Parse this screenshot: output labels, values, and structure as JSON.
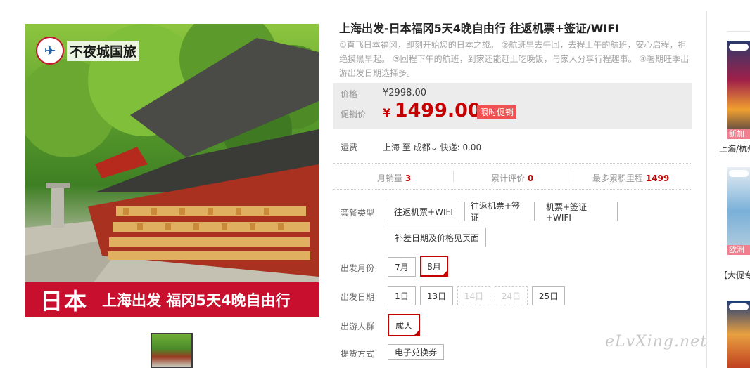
{
  "image": {
    "logo_text": "不夜城国旅",
    "banner_main": "日本",
    "banner_sub": "上海出发 福冈5天4晚自由行"
  },
  "product": {
    "title": "上海出发-日本福冈5天4晚自由行 往返机票+签证/WIFI",
    "description": "①直飞日本福冈，即刻开始您的日本之旅。 ②航班早去午回，去程上午的航班，安心启程，拒绝摸黑早起。 ③回程下午的航班，到家还能赶上吃晚饭，与家人分享行程趣事。 ④署期旺季出游出发日期选择多。"
  },
  "price": {
    "orig_label": "价格",
    "orig_value": "¥2998.00",
    "sale_label": "促销价",
    "sale_currency": "¥",
    "sale_value": "1499.00",
    "sale_tag": "限时促销"
  },
  "shipping": {
    "label": "运费",
    "from": "上海",
    "to_word": "至",
    "to": "成都",
    "method": "快递: 0.00"
  },
  "stats": {
    "monthly_label": "月销量",
    "monthly_value": "3",
    "reviews_label": "累计评价",
    "reviews_value": "0",
    "mileage_label": "最多累积里程",
    "mileage_value": "1499"
  },
  "options": {
    "package_label": "套餐类型",
    "packages": [
      "往返机票+WIFI",
      "往返机票+签证",
      "机票+签证+WIFI",
      "补差日期及价格见页面"
    ],
    "month_label": "出发月份",
    "months": [
      "7月",
      "8月"
    ],
    "date_label": "出发日期",
    "dates": [
      "1日",
      "13日",
      "14日",
      "24日",
      "25日"
    ],
    "group_label": "出游人群",
    "groups": [
      "成人"
    ],
    "delivery_label": "提货方式",
    "deliveries": [
      "电子兑换券"
    ]
  },
  "sidebar": {
    "item1_strip": "新加",
    "item1_text": "上海/杭州",
    "item2_strip": "欧洲",
    "item2_text": "【大促专",
    "item3_strip": ""
  },
  "watermark": "eLvXing.net"
}
